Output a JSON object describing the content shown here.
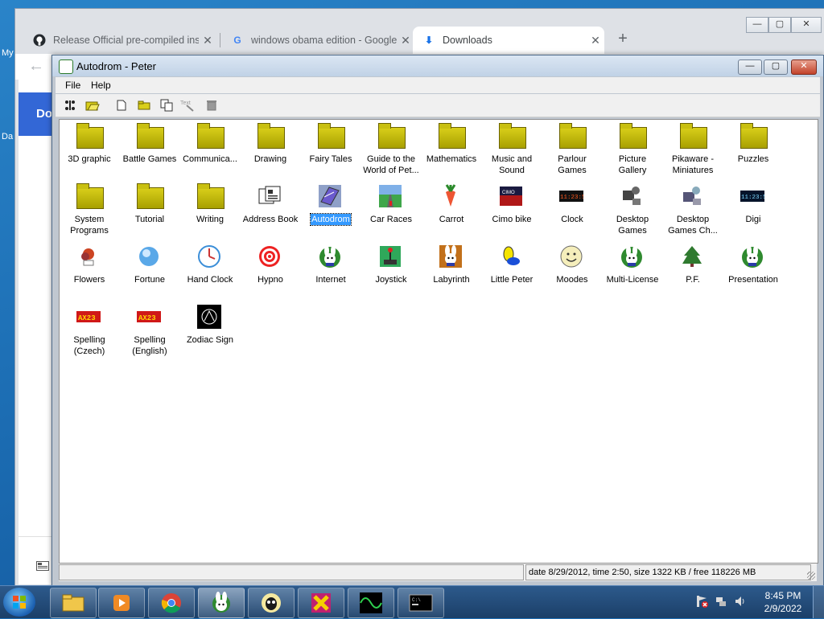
{
  "desktop": {
    "labels": [
      "My",
      "Da"
    ]
  },
  "browser": {
    "tabs": [
      {
        "title": "Release Official pre-compiled ins",
        "icon": "github-icon"
      },
      {
        "title": "windows obama edition - Google",
        "icon": "google-icon"
      },
      {
        "title": "Downloads",
        "icon": "download-icon"
      }
    ],
    "new_tab": "+",
    "controls": {
      "minimize": "—",
      "maximize": "▢",
      "close": "✕"
    },
    "back": "←",
    "downloads_heading": "Do"
  },
  "app": {
    "title": "Autodrom - Peter",
    "controls": {
      "minimize": "—",
      "maximize": "▢",
      "close": "✕"
    },
    "menu": [
      "File",
      "Help"
    ],
    "toolbar_text_label": "Text",
    "items": [
      {
        "label": "3D graphic",
        "type": "folder"
      },
      {
        "label": "Battle Games",
        "type": "folder"
      },
      {
        "label": "Communica...",
        "type": "folder"
      },
      {
        "label": "Drawing",
        "type": "folder"
      },
      {
        "label": "Fairy Tales",
        "type": "folder"
      },
      {
        "label": "Guide to the World of Pet...",
        "type": "folder"
      },
      {
        "label": "Mathematics",
        "type": "folder"
      },
      {
        "label": "Music and Sound",
        "type": "folder"
      },
      {
        "label": "Parlour Games",
        "type": "folder"
      },
      {
        "label": "Picture Gallery",
        "type": "folder"
      },
      {
        "label": "Pikaware - Miniatures",
        "type": "folder"
      },
      {
        "label": "Puzzles",
        "type": "folder"
      },
      {
        "label": "System Programs",
        "type": "folder"
      },
      {
        "label": "Tutorial",
        "type": "folder"
      },
      {
        "label": "Writing",
        "type": "folder"
      },
      {
        "label": "Address Book",
        "type": "address-book"
      },
      {
        "label": "Autodrom",
        "type": "autodrom",
        "selected": true
      },
      {
        "label": "Car Races",
        "type": "car-races"
      },
      {
        "label": "Carrot",
        "type": "carrot"
      },
      {
        "label": "Cimo bike",
        "type": "cimo-bike"
      },
      {
        "label": "Clock",
        "type": "clock-digital",
        "text": "11:23:51"
      },
      {
        "label": "Desktop Games",
        "type": "desktop-games"
      },
      {
        "label": "Desktop Games Ch...",
        "type": "desktop-games-ch"
      },
      {
        "label": "Digi",
        "type": "digi",
        "text": "11:23:51"
      },
      {
        "label": "Flowers",
        "type": "flowers"
      },
      {
        "label": "Fortune",
        "type": "fortune"
      },
      {
        "label": "Hand Clock",
        "type": "hand-clock"
      },
      {
        "label": "Hypno",
        "type": "hypno"
      },
      {
        "label": "Internet",
        "type": "internet"
      },
      {
        "label": "Joystick",
        "type": "joystick"
      },
      {
        "label": "Labyrinth",
        "type": "labyrinth"
      },
      {
        "label": "Little Peter",
        "type": "little-peter"
      },
      {
        "label": "Moodes",
        "type": "moodes"
      },
      {
        "label": "Multi-License",
        "type": "multi-license"
      },
      {
        "label": "P.F.",
        "type": "pf"
      },
      {
        "label": "Presentation",
        "type": "presentation"
      },
      {
        "label": "Spelling (Czech)",
        "type": "spelling",
        "text": "AX23"
      },
      {
        "label": "Spelling (English)",
        "type": "spelling",
        "text": "AX23"
      },
      {
        "label": "Zodiac Sign",
        "type": "zodiac"
      }
    ],
    "status": "date 8/29/2012, time 2:50, size 1322 KB / free 118226 MB"
  },
  "taskbar": {
    "apps": [
      "explorer-icon",
      "media-player-icon",
      "chrome-icon",
      "pikaware-icon",
      "alien-icon",
      "xtools-icon",
      "oscilloscope-icon",
      "cmd-icon"
    ],
    "time": "8:45 PM",
    "date": "2/9/2022"
  },
  "colors": {
    "folder": "#c9c010",
    "selection": "#3399ff",
    "taskbar": "#1b3f68"
  }
}
